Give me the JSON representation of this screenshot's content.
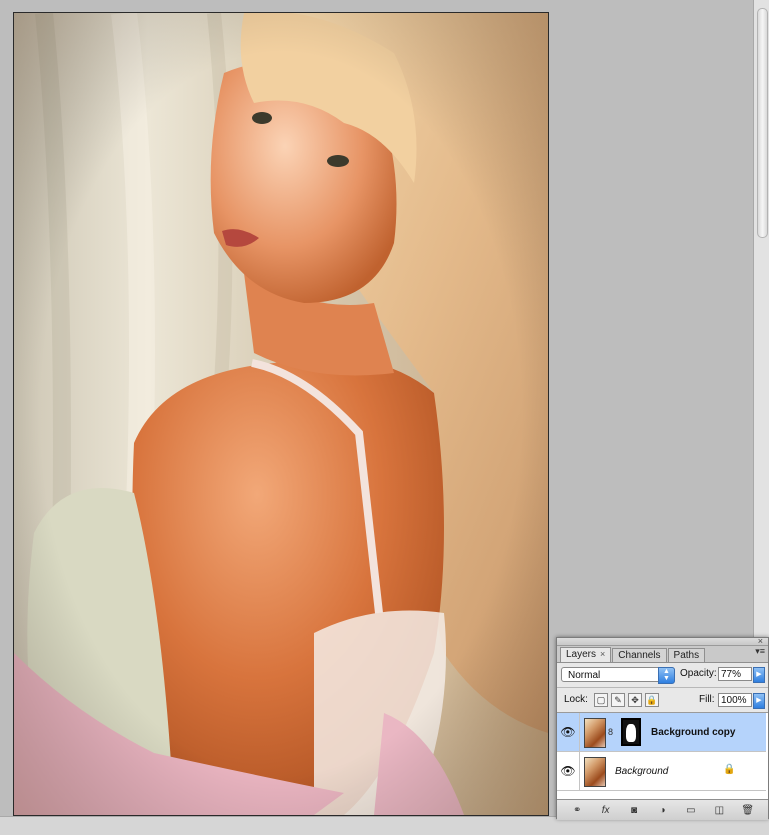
{
  "panel": {
    "close_glyph": "×",
    "tabs": [
      {
        "label": "Layers",
        "close": "×"
      },
      {
        "label": "Channels"
      },
      {
        "label": "Paths"
      }
    ],
    "menu_glyph": "▾≡",
    "blend_mode": "Normal",
    "opacity_label": "Opacity:",
    "opacity_value": "77%",
    "lock_label": "Lock:",
    "fill_label": "Fill:",
    "fill_value": "100%",
    "layers": [
      {
        "name": "Background copy",
        "visible": true,
        "selected": true
      },
      {
        "name": "Background",
        "visible": true,
        "locked": true
      }
    ],
    "footer_icons": [
      "link-icon",
      "fx-icon",
      "mask-icon",
      "adjustment-icon",
      "group-icon",
      "new-layer-icon",
      "trash-icon"
    ],
    "footer_glyphs": [
      "⚭",
      "fx",
      "◙",
      "◑",
      "▭",
      "◫",
      "🗑"
    ],
    "eye_glyph": "👁",
    "chain_glyph": "8",
    "lock_glyph": "🔒",
    "lock_glyphs": [
      "▢",
      "✎",
      "✥",
      "🔒"
    ]
  }
}
